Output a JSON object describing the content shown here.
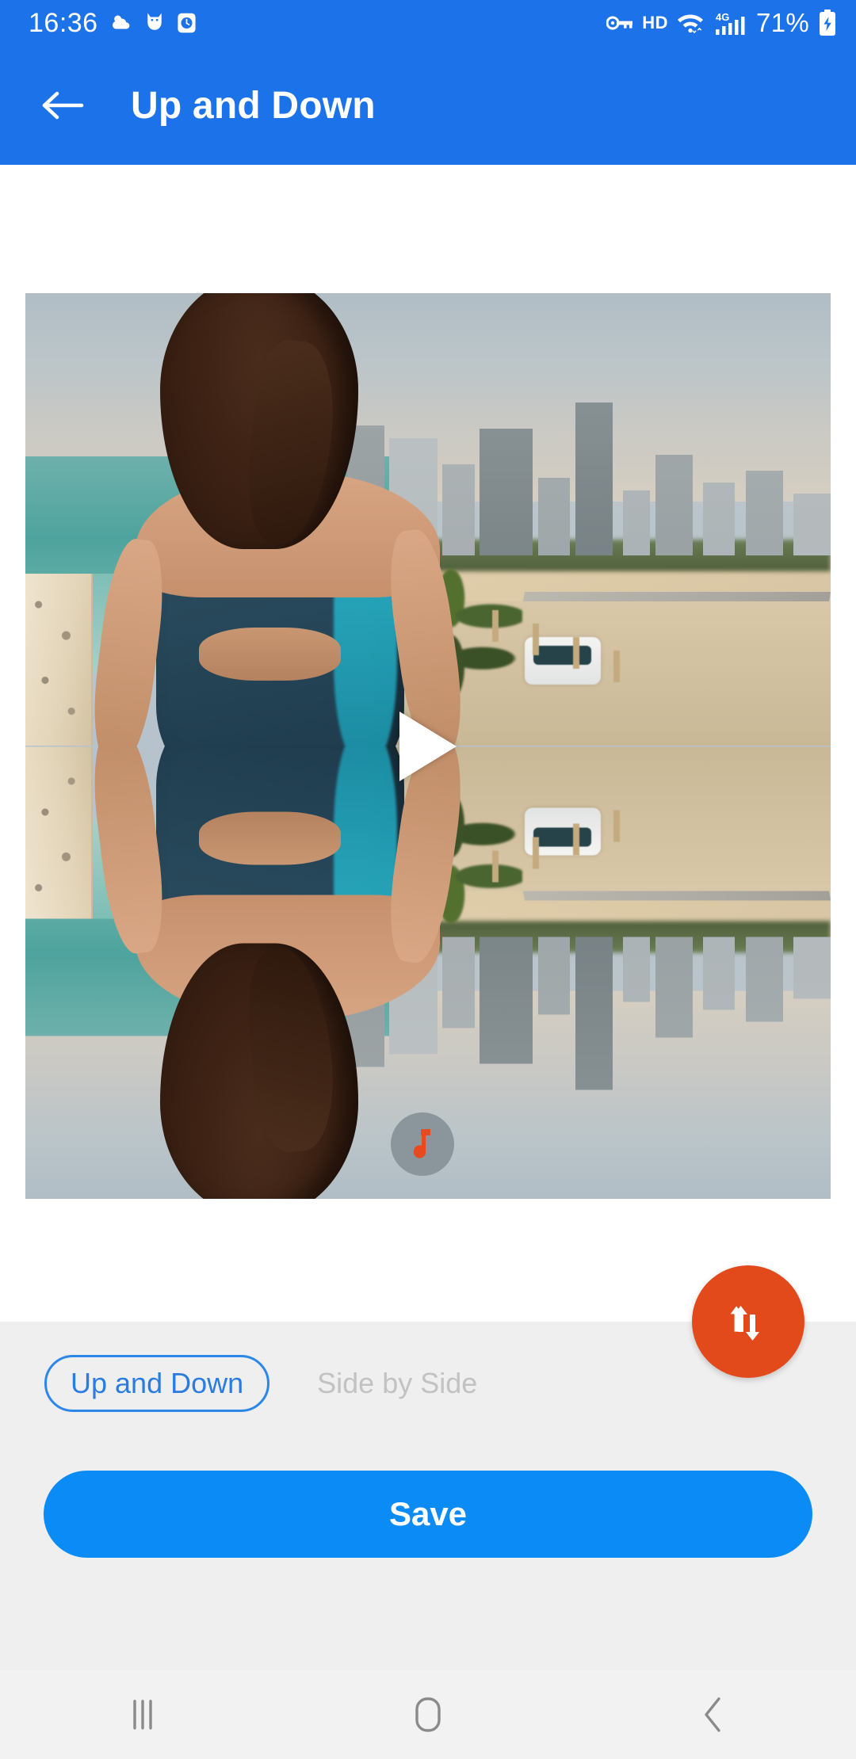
{
  "statusbar": {
    "time": "16:36",
    "left_icons": [
      "weather-partly-cloudy-icon",
      "cat-app-icon",
      "clock-icon"
    ],
    "hd_label": "HD",
    "network_label": "4G",
    "battery_percent": "71%",
    "right_icons": [
      "vpn-key-icon",
      "wifi-icon",
      "signal-bars-icon",
      "battery-charging-icon"
    ],
    "background_color": "#1C72E8"
  },
  "appbar": {
    "title": "Up and Down",
    "back_icon": "arrow-left-icon",
    "background_color": "#1C72E8",
    "title_color": "#FFFFFF"
  },
  "preview": {
    "type": "video-preview-mirror",
    "play_icon": "play-triangle-icon",
    "music_icon": "music-note-icon",
    "music_badge_color": "#8B959C",
    "music_note_color": "#E8491D",
    "scene_description": "Woman in blue dress facing a beach city skyline, mirrored vertically"
  },
  "fab": {
    "icon": "swap-vertical-arrows-icon",
    "color": "#E2491B",
    "icon_color": "#FFFFFF"
  },
  "panel": {
    "background_color": "#EFEFEF",
    "tabs": [
      {
        "label": "Up and Down",
        "selected": true
      },
      {
        "label": "Side by Side",
        "selected": false
      }
    ],
    "selected_tab_color": "#2B7CE0",
    "unselected_tab_color": "#C2C2C2",
    "save_label": "Save",
    "save_color": "#0A8BF5"
  },
  "navbar": {
    "buttons": [
      {
        "name": "recents",
        "icon": "recents-bars-icon"
      },
      {
        "name": "home",
        "icon": "home-square-icon"
      },
      {
        "name": "back",
        "icon": "chevron-left-icon"
      }
    ],
    "background_color": "#F2F2F2",
    "icon_color": "#8A8A8A"
  }
}
